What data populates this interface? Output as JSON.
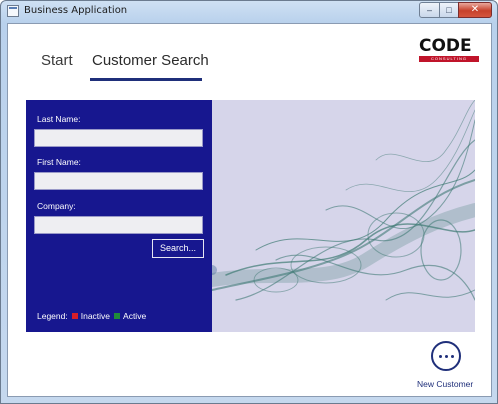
{
  "window": {
    "title": "Business Application",
    "controls": {
      "minimize": "–",
      "maximize": "□",
      "close": "✕"
    }
  },
  "nav": {
    "tabs": [
      {
        "label": "Start",
        "selected": false
      },
      {
        "label": "Customer Search",
        "selected": true
      }
    ]
  },
  "logo": {
    "word": "CODE",
    "sub": "CONSULTING"
  },
  "search_form": {
    "last_name": {
      "label": "Last Name:",
      "value": "",
      "placeholder": ""
    },
    "first_name": {
      "label": "First Name:",
      "value": "",
      "placeholder": ""
    },
    "company": {
      "label": "Company:",
      "value": "",
      "placeholder": ""
    },
    "search_button": "Search...",
    "legend": {
      "title": "Legend:",
      "items": [
        {
          "label": "Inactive",
          "color": "#d81e2a"
        },
        {
          "label": "Active",
          "color": "#1f8a3a"
        }
      ]
    }
  },
  "actions": {
    "new_customer": {
      "label": "New Customer",
      "icon": "more-icon"
    }
  },
  "colors": {
    "accent": "#1f2f7a",
    "panel": "#17178f",
    "banner": "#d6d5ea",
    "smoke": "#3f7a74"
  }
}
